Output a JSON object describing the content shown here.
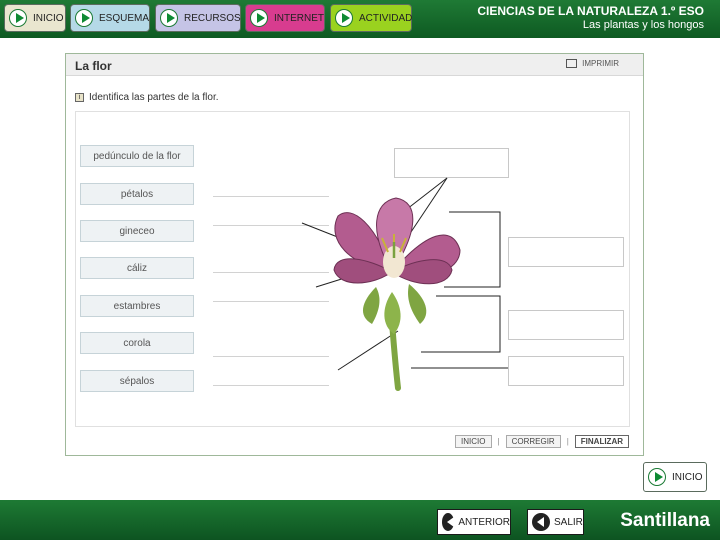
{
  "topbar": {
    "nav": [
      {
        "label": "INICIO"
      },
      {
        "label": "ESQUEMA"
      },
      {
        "label": "RECURSOS"
      },
      {
        "label": "INTERNET"
      },
      {
        "label": "ACTIVIDAD"
      }
    ],
    "course_title": "CIENCIAS DE LA NATURALEZA 1.º ESO",
    "course_subtitle": "Las plantas y los hongos",
    "color": "#0e5a22"
  },
  "activity": {
    "title": "La flor",
    "print_label": "IMPRIMIR",
    "instruction": "Identifica las partes de la flor.",
    "labels": [
      {
        "label": "pedúnculo de la flor"
      },
      {
        "label": "pétalos"
      },
      {
        "label": "gineceo"
      },
      {
        "label": "cáliz"
      },
      {
        "label": "estambres"
      },
      {
        "label": "corola"
      },
      {
        "label": "sépalos"
      }
    ],
    "buttons": {
      "inicio": "INICIO",
      "corregir": "CORREGIR",
      "finalizar": "FINALIZAR"
    }
  },
  "nav_bottom": {
    "inicio": "INICIO",
    "anterior": "ANTERIOR",
    "salir": "SALIR",
    "brand": "Santillana"
  },
  "icons": [
    "play-icon",
    "print-icon",
    "info-icon",
    "back-icon"
  ],
  "colors": {
    "flower_petal": "#b35c8f",
    "stem": "#7fa542",
    "accent_green": "#0e8a33"
  }
}
